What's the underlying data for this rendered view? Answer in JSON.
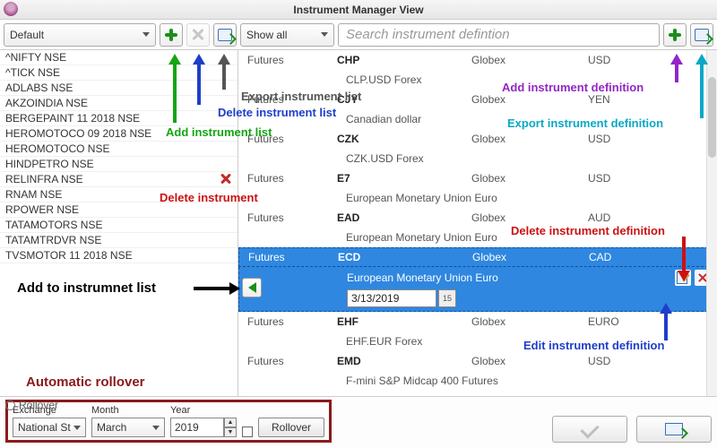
{
  "title": "Instrument Manager View",
  "toolbar": {
    "list_selector": "Default",
    "showall": "Show all",
    "search_placeholder": "Search instrument defintion"
  },
  "left_items": [
    "^NIFTY NSE",
    "^TICK NSE",
    "ADLABS NSE",
    "AKZOINDIA NSE",
    "BERGEPAINT 11 2018 NSE",
    "HEROMOTOCO 09 2018 NSE",
    "HEROMOTOCO NSE",
    "HINDPETRO NSE",
    "RELINFRA NSE",
    "RNAM NSE",
    "RPOWER NSE",
    "TATAMOTORS NSE",
    "TATAMTRDVR NSE",
    "TVSMOTOR 11 2018 NSE"
  ],
  "left_selected_index": 8,
  "grid": [
    {
      "type": "row",
      "c1": "Futures",
      "c2": "CHP",
      "c3": "Globex",
      "c4": "USD"
    },
    {
      "type": "sub",
      "text": "CLP.USD Forex"
    },
    {
      "type": "row",
      "c1": "Futures",
      "c2": "CJY",
      "c3": "Globex",
      "c4": "YEN"
    },
    {
      "type": "sub",
      "text": "Canadian dollar"
    },
    {
      "type": "row",
      "c1": "Futures",
      "c2": "CZK",
      "c3": "Globex",
      "c4": "USD"
    },
    {
      "type": "sub",
      "text": "CZK.USD Forex"
    },
    {
      "type": "row",
      "c1": "Futures",
      "c2": "E7",
      "c3": "Globex",
      "c4": "USD"
    },
    {
      "type": "sub",
      "text": "European Monetary Union Euro"
    },
    {
      "type": "row",
      "c1": "Futures",
      "c2": "EAD",
      "c3": "Globex",
      "c4": "AUD"
    },
    {
      "type": "sub",
      "text": "European Monetary Union Euro"
    },
    {
      "type": "selrow",
      "c1": "Futures",
      "c2": "ECD",
      "c3": "Globex",
      "c4": "CAD"
    },
    {
      "type": "selsub",
      "text": "European Monetary Union Euro"
    },
    {
      "type": "seldate",
      "date": "3/13/2019",
      "cal": "15"
    },
    {
      "type": "row",
      "c1": "Futures",
      "c2": "EHF",
      "c3": "Globex",
      "c4": "EURO"
    },
    {
      "type": "sub",
      "text": "EHF.EUR Forex"
    },
    {
      "type": "row",
      "c1": "Futures",
      "c2": "EMD",
      "c3": "Globex",
      "c4": "USD"
    },
    {
      "type": "sub",
      "text": "F-mini S&P Midcap 400 Futures"
    }
  ],
  "rollover": {
    "radio_label": "Rollover",
    "exchange_label": "Exchange",
    "exchange_value": "National St",
    "month_label": "Month",
    "month_value": "March",
    "year_label": "Year",
    "year_value": "2019",
    "button": "Rollover"
  },
  "annotations": {
    "add_list": "Add instrument list",
    "del_list": "Delete instrument list",
    "export_list": "Export instrument list",
    "del_instr": "Delete instrument",
    "add_def": "Add instrument definition",
    "export_def": "Export instrument definition",
    "del_def": "Delete instrument definition",
    "edit_def": "Edit instrument definition",
    "add_to_list": "Add to instrumnet list",
    "auto_rollover": "Automatic rollover"
  }
}
